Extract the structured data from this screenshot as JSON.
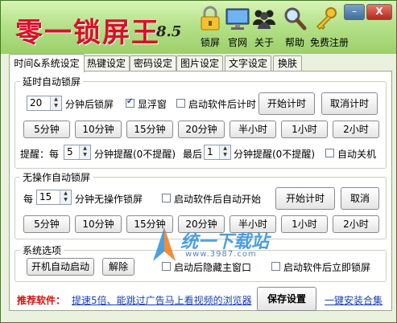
{
  "app": {
    "title": "零一锁屏王",
    "version": "8.5"
  },
  "toolbar": [
    {
      "label": "锁屏",
      "icon": "lock-icon"
    },
    {
      "label": "官网",
      "icon": "monitor-icon"
    },
    {
      "label": "关于",
      "icon": "users-icon"
    },
    {
      "label": "帮助",
      "icon": "magnifier-icon"
    },
    {
      "label": "免费注册",
      "icon": "key-icon"
    }
  ],
  "window": {
    "minimize": "–",
    "close": "X"
  },
  "tabs": [
    "时间&系统设定",
    "热键设定",
    "密码设定",
    "图片设定",
    "文字设定",
    "换肤"
  ],
  "delay_lock": {
    "title": "延时自动锁屏",
    "minutes_value": "20",
    "minutes_suffix": "分钟后锁屏",
    "float_window_label": "显浮窗",
    "float_window_checked": true,
    "start_after_launch_label": "启动软件后计时",
    "start_button": "开始计时",
    "cancel_button": "取消计时",
    "presets": [
      "5分钟",
      "10分钟",
      "15分钟",
      "20分钟",
      "半小时",
      "1小时",
      "2小时"
    ]
  },
  "reminder": {
    "prefix": "提醒：每",
    "every_value": "5",
    "every_suffix": "分钟提醒(0不提醒)",
    "last_prefix": "最后",
    "last_value": "1",
    "last_suffix": "分钟提醒(0不提醒)",
    "auto_shutdown_label": "自动关机"
  },
  "idle_lock": {
    "title": "无操作自动锁屏",
    "prefix": "每",
    "minutes_value": "15",
    "minutes_suffix": "分钟无操作锁屏",
    "start_after_launch_label": "启动软件后自动开始",
    "start_button": "开始计时",
    "cancel_button": "取消",
    "presets": [
      "5分钟",
      "10分钟",
      "15分钟",
      "20分钟",
      "半小时",
      "1小时",
      "2小时"
    ]
  },
  "system": {
    "title": "系统选项",
    "autostart_button": "开机自动启动",
    "remove_button": "解除",
    "hide_window_label": "启动后隐藏主窗口",
    "lock_on_start_label": "启动软件后立即锁屏"
  },
  "footer": {
    "recommend_label": "推荐软件：",
    "recommend_link": "提速5倍、能跳过广告马上看视频的浏览器",
    "save_button": "保存设置",
    "install_link": "一键安装合集"
  },
  "watermark": {
    "text": "统一下载站",
    "sub": "www.3987.com"
  }
}
